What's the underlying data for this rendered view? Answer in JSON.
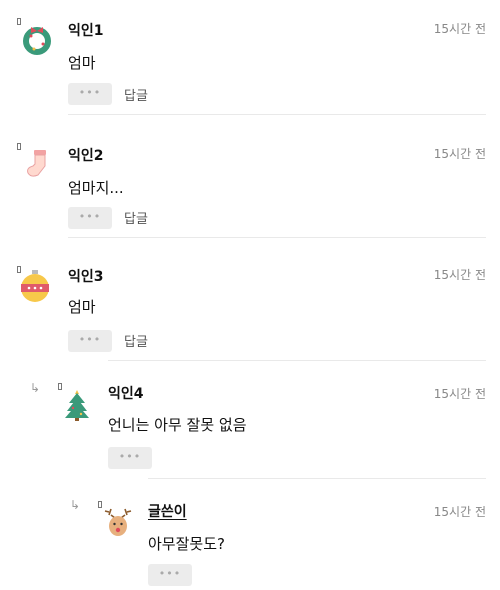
{
  "comments": [
    {
      "author": "익인1",
      "time": "15시간 전",
      "text": "엄마",
      "more": "•••",
      "reply": "답글",
      "avatar": "wreath-icon"
    },
    {
      "author": "익인2",
      "time": "15시간 전",
      "text": "엄마지...",
      "more": "•••",
      "reply": "답글",
      "avatar": "stocking-icon"
    },
    {
      "author": "익인3",
      "time": "15시간 전",
      "text": "엄마",
      "more": "•••",
      "reply": "답글",
      "avatar": "ornament-icon"
    },
    {
      "author": "익인4",
      "time": "15시간 전",
      "text": "언니는 아무 잘못 없음",
      "more": "•••",
      "avatar": "christmas-tree-icon"
    },
    {
      "author": "글쓴이",
      "time": "15시간 전",
      "text": "아무잘못도?",
      "more": "•••",
      "avatar": "reindeer-icon"
    }
  ],
  "colors": {
    "divider": "#e9e9e9",
    "button_bg": "#ececec",
    "time": "#888888"
  }
}
